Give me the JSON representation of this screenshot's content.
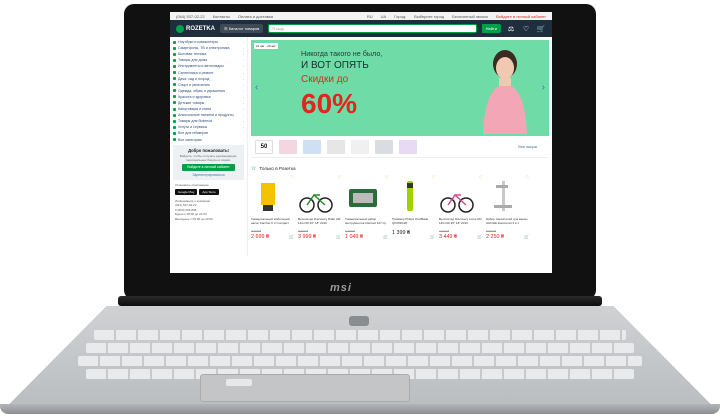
{
  "laptop": {
    "brand": "msi"
  },
  "topbar": {
    "phone": "(044) 537-02-22",
    "contacts": "Контакты",
    "delivery": "Оплата и доставка",
    "lang_ru": "RU",
    "lang_ua": "UA",
    "city_label": "Город:",
    "city_value": "Выберите город",
    "help": "Бесплатный звонок",
    "signin": "Войдите в личный кабинет"
  },
  "header": {
    "brand": "ROZETKA",
    "catalog_button": "Каталог товаров",
    "search_placeholder": "Я ищу",
    "search_button": "Найти"
  },
  "sidebar": {
    "items": [
      {
        "label": "Ноутбуки и компьютеры"
      },
      {
        "label": "Смартфоны, ТВ и электроника"
      },
      {
        "label": "Бытовая техника"
      },
      {
        "label": "Товары для дома"
      },
      {
        "label": "Инструменты и автотовары"
      },
      {
        "label": "Сантехника и ремонт"
      },
      {
        "label": "Дача, сад и огород"
      },
      {
        "label": "Спорт и увлечения"
      },
      {
        "label": "Одежда, обувь и украшения"
      },
      {
        "label": "Красота и здоровье"
      },
      {
        "label": "Детские товары"
      },
      {
        "label": "Канцтовары и книги"
      },
      {
        "label": "Алкогольные напитки и продукты"
      },
      {
        "label": "Товары для бизнеса"
      },
      {
        "label": "Услуги и сервисы"
      },
      {
        "label": "Все для геймеров"
      },
      {
        "label": "Все категории"
      }
    ],
    "welcome_title": "Добро пожаловать!",
    "welcome_desc": "Войдите, чтобы получать рекомендации, персональные бонусы и скидки.",
    "welcome_button": "Войдите в личный кабинет",
    "welcome_link": "Зарегистрироваться",
    "apps_label": "Установить приложение",
    "store_google": "Google Play",
    "store_apple": "App Store",
    "contacts_label": "Информация о компании",
    "phone1": "(044) 537-02-22",
    "phone2": "0 (800) 503-808",
    "schedule1": "Будни",
    "schedule1_time": "с 08:00 до 21:00",
    "schedule2": "Выходные",
    "schedule2_time": "с 09:00 до 20:00"
  },
  "banner": {
    "date_range": "21 авг - 29 авг",
    "line1": "Никогда такого не было,",
    "line2": "И ВОТ ОПЯТЬ",
    "line3": "Скидки до",
    "percent": "60%",
    "prev_icon": "chevron-left-icon",
    "next_icon": "chevron-right-icon"
  },
  "thumbs": {
    "first": "50",
    "all_link": "Все акции"
  },
  "section": {
    "title": "Только в Розетка"
  },
  "products": [
    {
      "name": "Универсальный мобильный насос Karcher K 2 Compact",
      "price": "2 699 ₴",
      "old": "3 199 ₴",
      "red": true
    },
    {
      "name": "Велосипед Discovery Rider AM 14G DD 26\" 18\" 2019",
      "price": "3 999 ₴",
      "old": "4 999 ₴",
      "red": true
    },
    {
      "name": "Универсальный набор инструментов Intertool 107 пр.",
      "price": "1 049 ₴",
      "old": "1 499 ₴",
      "red": true
    },
    {
      "name": "Триммер Philips OneBlade QP2520/20",
      "price": "1 399 ₴",
      "old": "",
      "red": false
    },
    {
      "name": "Велосипед Discovery Lotus AM 14G DD 26\" 18\" 2019",
      "price": "3 449 ₴",
      "old": "4 299 ₴",
      "red": true
    },
    {
      "name": "Набор смесителей для ванны GROHE Eurosmart 3 в 1",
      "price": "2 250 ₴",
      "old": "3 009 ₴",
      "red": true
    }
  ],
  "colors": {
    "accent": "#00a046",
    "header": "#1f2e3c",
    "price": "#e0261d",
    "banner": "#6fdca7"
  }
}
